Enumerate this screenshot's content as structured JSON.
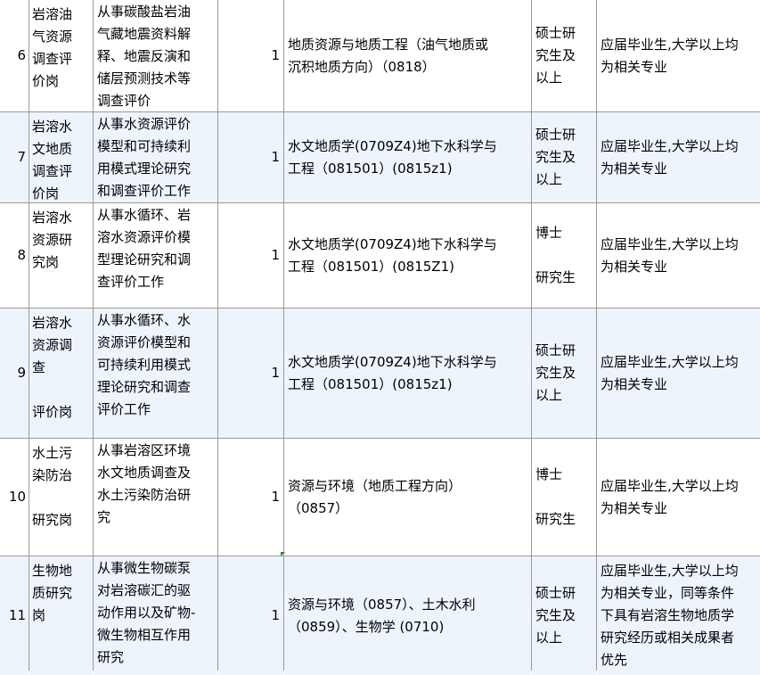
{
  "rows": [
    {
      "no": "6",
      "position": "岩溶油\n气资源\n调查评\n价岗",
      "duty": "从事碳酸盐岩油\n气藏地震资料解\n释、地震反演和\n储层预测技术等\n调查评价",
      "count": "1",
      "major": "地质资源与地质工程（油气地质或\n沉积地质方向）（0818）",
      "education": "硕士研\n究生及\n以上",
      "requirement": "应届毕业生,大学以上均\n为相关专业"
    },
    {
      "no": "7",
      "position": "岩溶水\n文地质\n调查评\n价岗",
      "duty": "从事水资源评价\n模型和可持续利\n用模式理论研究\n和调查评价工作",
      "count": "1",
      "major": "水文地质学(0709Z4)地下水科学与\n工程（081501）(0815z1)",
      "education": "硕士研\n究生及\n以上",
      "requirement": "应届毕业生,大学以上均\n为相关专业"
    },
    {
      "no": "8",
      "position": "岩溶水\n资源研\n究岗",
      "duty": "从事水循环、岩\n溶水资源评价模\n型理论研究和调\n查评价工作",
      "count": "1",
      "major": "水文地质学(0709Z4)地下水科学与\n工程（081501）(0815Z1)",
      "education": "博士\n\n研究生",
      "requirement": "应届毕业生,大学以上均\n为相关专业"
    },
    {
      "no": "9",
      "position": "岩溶水\n资源调\n查\n\n评价岗",
      "duty": "从事水循环、水\n资源评价模型和\n可持续利用模式\n理论研究和调查\n评价工作",
      "count": "1",
      "major": "水文地质学(0709Z4)地下水科学与\n工程（081501）(0815z1)",
      "education": "硕士研\n究生及\n以上",
      "requirement": "应届毕业生,大学以上均\n为相关专业"
    },
    {
      "no": "10",
      "position": "水土污\n染防治\n\n研究岗",
      "duty": "从事岩溶区环境\n水文地质调查及\n水土污染防治研\n究",
      "count": "1",
      "major": "资源与环境（地质工程方向）\n（0857）",
      "education": "博士\n\n研究生",
      "requirement": "应届毕业生,大学以上均\n为相关专业"
    },
    {
      "no": "11",
      "position": "生物地\n质研究\n岗",
      "duty": "从事微生物碳泵\n对岩溶碳汇的驱\n动作用以及矿物-\n微生物相互作用\n研究",
      "count": "1",
      "major": "资源与环境（0857）、土木水利\n（0859）、生物学 (0710)",
      "education": "硕士研\n究生及\n以上",
      "requirement": "应届毕业生,大学以上均\n为相关专业，同等条件\n下具有岩溶生物地质学\n研究经历或相关成果者\n优先"
    }
  ]
}
